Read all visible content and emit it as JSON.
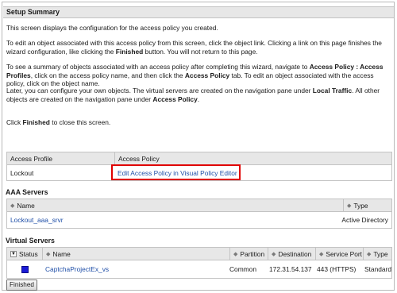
{
  "setup_summary": {
    "title": "Setup Summary",
    "p1": "This screen displays the configuration for the access policy you created.",
    "p2a": "To edit an object associated with this access policy from this screen, click the object link. Clicking a link on this page finishes the wizard configuration, like clicking the ",
    "p2b": "Finished",
    "p2c": " button. You will not return to this page.",
    "p3a": "To see a summary of objects associated with an access policy after completing this wizard, navigate to ",
    "p3b": "Access Policy : Access Profiles",
    "p3c": ", click on the access policy name, and then click the ",
    "p3d": "Access Policy",
    "p3e": " tab. To edit an object associated with the access policy, click on the object name.",
    "p4a": "Later, you can configure your own objects. The virtual servers are created on the navigation pane under ",
    "p4b": "Local Traffic",
    "p4c": ". All other objects are created on the navigation pane under ",
    "p4d": "Access Policy",
    "p4e": ".",
    "p5a": "Click ",
    "p5b": "Finished",
    "p5c": " to close this screen."
  },
  "access_table": {
    "headers": [
      "Access Profile",
      "Access Policy"
    ],
    "row": {
      "profile": "Lockout",
      "policy_link": "Edit Access Policy in Visual Policy Editor"
    }
  },
  "aaa": {
    "title": "AAA Servers",
    "headers": [
      "Name",
      "Type"
    ],
    "row": {
      "name": "Lockout_aaa_srvr",
      "type": "Active Directory"
    }
  },
  "virtual": {
    "title": "Virtual Servers",
    "headers": [
      "Status",
      "Name",
      "Partition",
      "Destination",
      "Service Port",
      "Type"
    ],
    "row": {
      "status_color": "#1b1bd6",
      "name": "CaptchaProjectEx_vs",
      "partition": "Common",
      "destination": "172.31.54.137",
      "service_port": "443 (HTTPS)",
      "type": "Standard"
    }
  },
  "finished_button": "Finished",
  "colors": {
    "link": "#1f4fa8",
    "highlight": "#e00000",
    "header_bg": "#e7e7e7"
  },
  "icons": {
    "sort": "sort-arrows-icon",
    "status": "status-square-icon",
    "dropdown": "dropdown-icon"
  }
}
